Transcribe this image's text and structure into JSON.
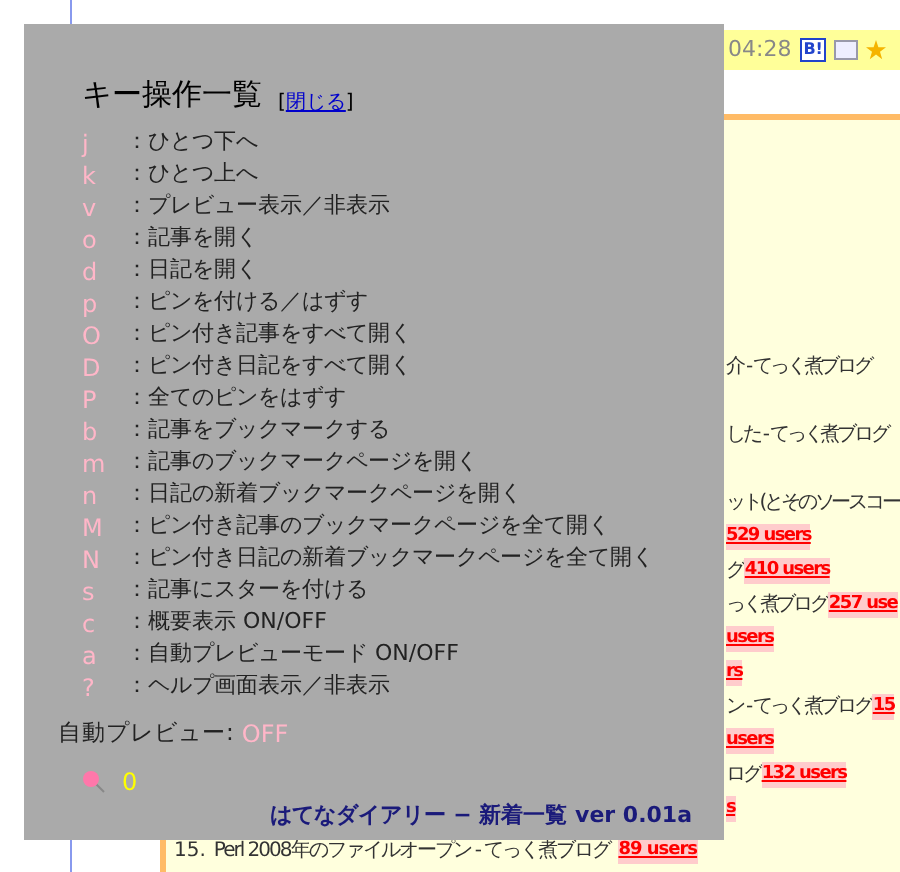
{
  "background": {
    "time": "04:28",
    "badge": "B!",
    "rows": [
      {
        "kind": "title",
        "title": "介 - てっく煮ブログ"
      },
      {
        "kind": "spacer"
      },
      {
        "kind": "title",
        "title": "した - てっく煮ブログ"
      },
      {
        "kind": "spacer"
      },
      {
        "kind": "title",
        "title": "ット(とそのソースコー"
      },
      {
        "kind": "users",
        "users": "529 users"
      },
      {
        "kind": "title_users",
        "title": "グ",
        "users": "410 users"
      },
      {
        "kind": "title_users",
        "title": "っく煮ブログ",
        "users": "257 use"
      },
      {
        "kind": "users",
        "users": "users"
      },
      {
        "kind": "users",
        "users": "rs"
      },
      {
        "kind": "title_users",
        "title": "ン - てっく煮ブログ",
        "users": "15"
      },
      {
        "kind": "users",
        "users": "users"
      },
      {
        "kind": "title_users",
        "title": "ログ",
        "users": "132 users"
      },
      {
        "kind": "users",
        "users": "s"
      }
    ],
    "last_row": {
      "number": "15.",
      "title": "Perl 2008年のファイルオープン - てっく煮ブログ",
      "users": "89 users"
    }
  },
  "help": {
    "title": "キー操作一覧",
    "close": "閉じる",
    "close_brackets": [
      "[",
      "]"
    ],
    "keys": [
      {
        "key": "j",
        "desc": "：ひとつ下へ"
      },
      {
        "key": "k",
        "desc": "：ひとつ上へ"
      },
      {
        "key": "v",
        "desc": "：プレビュー表示／非表示"
      },
      {
        "key": "o",
        "desc": "：記事を開く"
      },
      {
        "key": "d",
        "desc": "：日記を開く"
      },
      {
        "key": "p",
        "desc": "：ピンを付ける／はずす"
      },
      {
        "key": "O",
        "desc": "：ピン付き記事をすべて開く"
      },
      {
        "key": "D",
        "desc": "：ピン付き日記をすべて開く"
      },
      {
        "key": "P",
        "desc": "：全てのピンをはずす"
      },
      {
        "key": "b",
        "desc": "：記事をブックマークする"
      },
      {
        "key": "m",
        "desc": "：記事のブックマークページを開く"
      },
      {
        "key": "n",
        "desc": "：日記の新着ブックマークページを開く"
      },
      {
        "key": "M",
        "desc": "：ピン付き記事のブックマークページを全て開く"
      },
      {
        "key": "N",
        "desc": "：ピン付き日記の新着ブックマークページを全て開く"
      },
      {
        "key": "s",
        "desc": "：記事にスターを付ける"
      },
      {
        "key": "c",
        "desc": "：概要表示 ON/OFF"
      },
      {
        "key": "a",
        "desc": "：自動プレビューモード ON/OFF"
      },
      {
        "key": "?",
        "desc": "：ヘルプ画面表示／非表示"
      }
    ],
    "auto_preview_label": "自動プレビュー:",
    "auto_preview_value": "OFF",
    "pin_count": "0",
    "footer": "はてなダイアリー − 新着一覧 ver 0.01a"
  }
}
